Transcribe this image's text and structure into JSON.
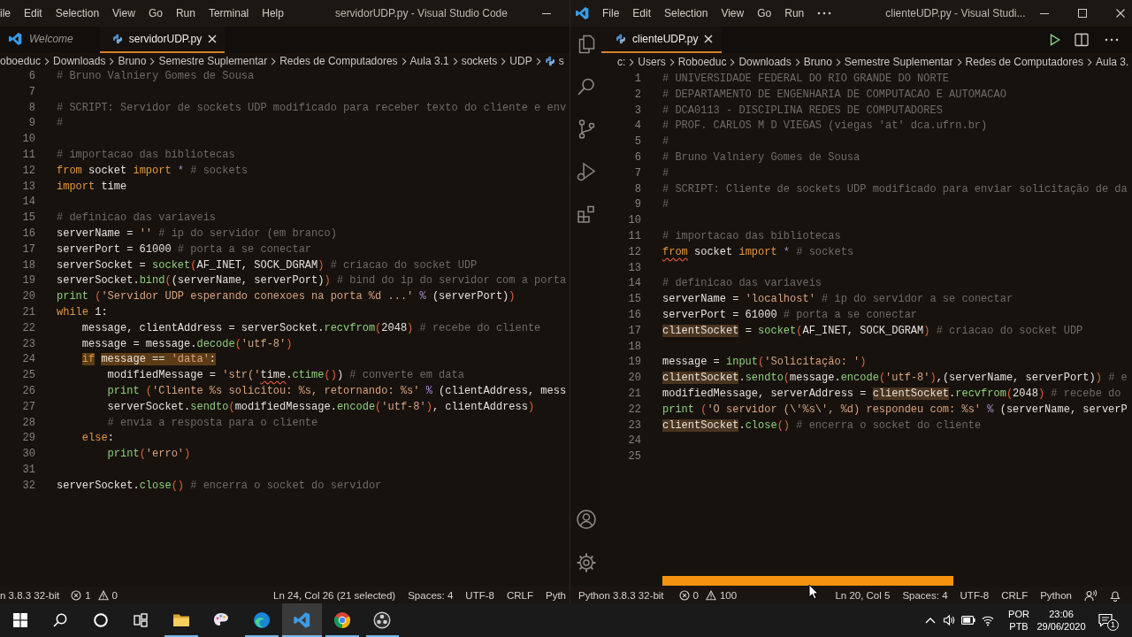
{
  "left_window": {
    "menu": [
      "ile",
      "Edit",
      "Selection",
      "View",
      "Go",
      "Run",
      "Terminal",
      "Help"
    ],
    "title": "servidorUDP.py - Visual Studio Code",
    "tabs": [
      {
        "label": "Welcome",
        "kind": "welcome",
        "selected": false
      },
      {
        "label": "servidorUDP.py",
        "kind": "file",
        "selected": true
      }
    ],
    "breadcrumb": [
      "oboeduc",
      "Downloads",
      "Bruno",
      "Semestre Suplementar",
      "Redes de Computadores",
      "Aula 3.1",
      "sockets",
      "UDP"
    ],
    "breadcrumb_file": "s",
    "code_lines": [
      {
        "number": "6",
        "tokens": [
          {
            "text": "# Bruno Valniery Gomes de Sousa",
            "kind": "comment",
            "highlighted": false,
            "squiggle": false
          }
        ]
      },
      {
        "number": "7"
      },
      {
        "number": "8",
        "tokens": [
          {
            "text": "# SCRIPT: Servidor de sockets UDP modificado para receber texto do cliente e env",
            "kind": "comment",
            "highlighted": false,
            "squiggle": false
          }
        ]
      },
      {
        "number": "9",
        "tokens": [
          {
            "text": "#",
            "kind": "comment",
            "highlighted": false,
            "squiggle": false
          }
        ]
      },
      {
        "number": "10"
      },
      {
        "number": "11",
        "tokens": [
          {
            "text": "# importacao das bibliotecas",
            "kind": "comment",
            "highlighted": false,
            "squiggle": false
          }
        ]
      },
      {
        "number": "12",
        "tokens": [
          {
            "text": "from",
            "kind": "keyword",
            "highlighted": false,
            "squiggle": false
          },
          {
            "text": " socket ",
            "kind": "plain",
            "highlighted": false,
            "squiggle": false
          },
          {
            "text": "import",
            "kind": "keyword",
            "highlighted": false,
            "squiggle": false
          },
          {
            "text": " *",
            "kind": "operator",
            "highlighted": false,
            "squiggle": false
          },
          {
            "text": " # sockets",
            "kind": "comment",
            "highlighted": false,
            "squiggle": false
          }
        ]
      },
      {
        "number": "13",
        "tokens": [
          {
            "text": "import",
            "kind": "keyword",
            "highlighted": false,
            "squiggle": false
          },
          {
            "text": " time",
            "kind": "plain",
            "highlighted": false,
            "squiggle": false
          }
        ]
      },
      {
        "number": "14"
      },
      {
        "number": "15",
        "tokens": [
          {
            "text": "# definicao das variaveis",
            "kind": "comment",
            "highlighted": false,
            "squiggle": false
          }
        ]
      },
      {
        "number": "16",
        "tokens": [
          {
            "text": "serverName = ",
            "kind": "plain",
            "highlighted": false,
            "squiggle": false
          },
          {
            "text": "''",
            "kind": "string",
            "highlighted": false,
            "squiggle": false
          },
          {
            "text": " # ip do servidor (em branco)",
            "kind": "comment",
            "highlighted": false,
            "squiggle": false
          }
        ]
      },
      {
        "number": "17",
        "tokens": [
          {
            "text": "serverPort = 61000",
            "kind": "plain",
            "highlighted": false,
            "squiggle": false
          },
          {
            "text": " # porta a se conectar",
            "kind": "comment",
            "highlighted": false,
            "squiggle": false
          }
        ]
      },
      {
        "number": "18",
        "tokens": [
          {
            "text": "serverSocket = ",
            "kind": "plain",
            "highlighted": false,
            "squiggle": false
          },
          {
            "text": "socket",
            "kind": "function",
            "highlighted": false,
            "squiggle": false
          },
          {
            "text": "(",
            "kind": "bracket",
            "highlighted": false,
            "squiggle": false
          },
          {
            "text": "AF_INET, SOCK_DGRAM",
            "kind": "plain",
            "highlighted": false,
            "squiggle": false
          },
          {
            "text": ")",
            "kind": "bracket",
            "highlighted": false,
            "squiggle": false
          },
          {
            "text": " # criacao do socket UDP",
            "kind": "comment",
            "highlighted": false,
            "squiggle": false
          }
        ]
      },
      {
        "number": "19",
        "tokens": [
          {
            "text": "serverSocket.",
            "kind": "plain",
            "highlighted": false,
            "squiggle": false
          },
          {
            "text": "bind",
            "kind": "function",
            "highlighted": false,
            "squiggle": false
          },
          {
            "text": "(",
            "kind": "bracket",
            "highlighted": false,
            "squiggle": false
          },
          {
            "text": "(serverName, serverPort)",
            "kind": "plain",
            "highlighted": false,
            "squiggle": false
          },
          {
            "text": ")",
            "kind": "bracket",
            "highlighted": false,
            "squiggle": false
          },
          {
            "text": " # bind do ip do servidor com a porta",
            "kind": "comment",
            "highlighted": false,
            "squiggle": false
          }
        ]
      },
      {
        "number": "20",
        "tokens": [
          {
            "text": "print",
            "kind": "function",
            "highlighted": false,
            "squiggle": false
          },
          {
            "text": " (",
            "kind": "bracket",
            "highlighted": false,
            "squiggle": false
          },
          {
            "text": "'Servidor UDP esperando conexoes na porta %d ...'",
            "kind": "string",
            "highlighted": false,
            "squiggle": false
          },
          {
            "text": " %",
            "kind": "operator",
            "highlighted": false,
            "squiggle": false
          },
          {
            "text": " (serverPort)",
            "kind": "plain",
            "highlighted": false,
            "squiggle": false
          },
          {
            "text": ")",
            "kind": "bracket",
            "highlighted": false,
            "squiggle": false
          }
        ]
      },
      {
        "number": "21",
        "tokens": [
          {
            "text": "while",
            "kind": "keyword",
            "highlighted": false,
            "squiggle": false
          },
          {
            "text": " 1:",
            "kind": "plain",
            "highlighted": false,
            "squiggle": false
          }
        ]
      },
      {
        "number": "22",
        "tokens": [
          {
            "text": "    message, clientAddress = serverSocket.",
            "kind": "plain",
            "highlighted": false,
            "squiggle": false
          },
          {
            "text": "recvfrom",
            "kind": "function",
            "highlighted": false,
            "squiggle": false
          },
          {
            "text": "(",
            "kind": "bracket",
            "highlighted": false,
            "squiggle": false
          },
          {
            "text": "2048",
            "kind": "plain",
            "highlighted": false,
            "squiggle": false
          },
          {
            "text": ")",
            "kind": "bracket",
            "highlighted": false,
            "squiggle": false
          },
          {
            "text": " # recebe do cliente",
            "kind": "comment",
            "highlighted": false,
            "squiggle": false
          }
        ]
      },
      {
        "number": "23",
        "tokens": [
          {
            "text": "    message = message.",
            "kind": "plain",
            "highlighted": false,
            "squiggle": false
          },
          {
            "text": "decode",
            "kind": "function",
            "highlighted": false,
            "squiggle": false
          },
          {
            "text": "(",
            "kind": "bracket",
            "highlighted": false,
            "squiggle": false
          },
          {
            "text": "'utf-8'",
            "kind": "string",
            "highlighted": false,
            "squiggle": false
          },
          {
            "text": ")",
            "kind": "bracket",
            "highlighted": false,
            "squiggle": false
          }
        ]
      },
      {
        "number": "24",
        "tokens": [
          {
            "text": "    if",
            "kind": "keyword",
            "highlighted": true,
            "squiggle": false
          },
          {
            "text": " message == ",
            "kind": "plain",
            "highlighted": true,
            "squiggle": false
          },
          {
            "text": "'data'",
            "kind": "string",
            "highlighted": true,
            "squiggle": false
          },
          {
            "text": ":",
            "kind": "plain",
            "highlighted": true,
            "squiggle": false
          }
        ]
      },
      {
        "number": "25",
        "tokens": [
          {
            "text": "        modifiedMessage = ",
            "kind": "plain",
            "highlighted": false,
            "squiggle": false
          },
          {
            "text": "'str('",
            "kind": "string",
            "highlighted": false,
            "squiggle": false
          },
          {
            "text": "time",
            "kind": "plain",
            "highlighted": false,
            "squiggle": true
          },
          {
            "text": ".",
            "kind": "plain",
            "highlighted": false,
            "squiggle": false
          },
          {
            "text": "ctime",
            "kind": "function",
            "highlighted": false,
            "squiggle": false
          },
          {
            "text": "()",
            "kind": "bracket",
            "highlighted": false,
            "squiggle": false
          },
          {
            "text": ")",
            "kind": "plain",
            "highlighted": false,
            "squiggle": false
          },
          {
            "text": " # converte em data",
            "kind": "comment",
            "highlighted": false,
            "squiggle": false
          }
        ]
      },
      {
        "number": "26",
        "tokens": [
          {
            "text": "        print",
            "kind": "function",
            "highlighted": false,
            "squiggle": false
          },
          {
            "text": " (",
            "kind": "bracket",
            "highlighted": false,
            "squiggle": false
          },
          {
            "text": "'Cliente %s solicitou: %s, retornando: %s'",
            "kind": "string",
            "highlighted": false,
            "squiggle": false
          },
          {
            "text": " %",
            "kind": "operator",
            "highlighted": false,
            "squiggle": false
          },
          {
            "text": " (clientAddress, mess",
            "kind": "plain",
            "highlighted": false,
            "squiggle": false
          }
        ]
      },
      {
        "number": "27",
        "tokens": [
          {
            "text": "        serverSocket.",
            "kind": "plain",
            "highlighted": false,
            "squiggle": false
          },
          {
            "text": "sendto",
            "kind": "function",
            "highlighted": false,
            "squiggle": false
          },
          {
            "text": "(",
            "kind": "bracket",
            "highlighted": false,
            "squiggle": false
          },
          {
            "text": "modifiedMessage.",
            "kind": "plain",
            "highlighted": false,
            "squiggle": false
          },
          {
            "text": "encode",
            "kind": "function",
            "highlighted": false,
            "squiggle": false
          },
          {
            "text": "(",
            "kind": "bracket",
            "highlighted": false,
            "squiggle": false
          },
          {
            "text": "'utf-8'",
            "kind": "string",
            "highlighted": false,
            "squiggle": false
          },
          {
            "text": ")",
            "kind": "bracket",
            "highlighted": false,
            "squiggle": false
          },
          {
            "text": ", clientAddress",
            "kind": "plain",
            "highlighted": false,
            "squiggle": false
          },
          {
            "text": ")",
            "kind": "bracket",
            "highlighted": false,
            "squiggle": false
          }
        ]
      },
      {
        "number": "28",
        "tokens": [
          {
            "text": "        # envia a resposta para o cliente",
            "kind": "comment",
            "highlighted": false,
            "squiggle": false
          }
        ]
      },
      {
        "number": "29",
        "tokens": [
          {
            "text": "    else",
            "kind": "keyword",
            "highlighted": false,
            "squiggle": false
          },
          {
            "text": ":",
            "kind": "plain",
            "highlighted": false,
            "squiggle": false
          }
        ]
      },
      {
        "number": "30",
        "tokens": [
          {
            "text": "        print",
            "kind": "function",
            "highlighted": false,
            "squiggle": false
          },
          {
            "text": "(",
            "kind": "bracket",
            "highlighted": false,
            "squiggle": false
          },
          {
            "text": "'erro'",
            "kind": "string",
            "highlighted": false,
            "squiggle": false
          },
          {
            "text": ")",
            "kind": "bracket",
            "highlighted": false,
            "squiggle": false
          }
        ]
      },
      {
        "number": "31"
      },
      {
        "number": "32",
        "tokens": [
          {
            "text": "serverSocket.",
            "kind": "plain",
            "highlighted": false,
            "squiggle": false
          },
          {
            "text": "close",
            "kind": "function",
            "highlighted": false,
            "squiggle": false
          },
          {
            "text": "()",
            "kind": "bracket",
            "highlighted": false,
            "squiggle": false
          },
          {
            "text": " # encerra o socket do servidor",
            "kind": "comment",
            "highlighted": false,
            "squiggle": false
          }
        ]
      }
    ],
    "status": {
      "interpreter": "n 3.8.3 32-bit",
      "errors": "1",
      "warnings": "0",
      "position": "Ln 24, Col 26 (21 selected)",
      "indentation": "Spaces: 4",
      "encoding": "UTF-8",
      "line_ending": "CRLF",
      "language": "Pyth"
    }
  },
  "right_window": {
    "menu": [
      "File",
      "Edit",
      "Selection",
      "View",
      "Go",
      "Run"
    ],
    "title": "clienteUDP.py - Visual Studi...",
    "tabs": [
      {
        "label": "clienteUDP.py",
        "kind": "file",
        "selected": true
      }
    ],
    "breadcrumb": [
      "c:",
      "Users",
      "Roboeduc",
      "Downloads",
      "Bruno",
      "Semestre Suplementar",
      "Redes de Computadores",
      "Aula 3."
    ],
    "code_lines": [
      {
        "number": "1",
        "tokens": [
          {
            "text": "# UNIVERSIDADE FEDERAL DO RIO GRANDE DO NORTE",
            "kind": "comment",
            "highlighted": false,
            "squiggle": false
          }
        ]
      },
      {
        "number": "2",
        "tokens": [
          {
            "text": "# DEPARTAMENTO DE ENGENHARIA DE COMPUTACAO E AUTOMACAO",
            "kind": "comment",
            "highlighted": false,
            "squiggle": false
          }
        ]
      },
      {
        "number": "3",
        "tokens": [
          {
            "text": "# DCA0113 - DISCIPLINA REDES DE COMPUTADORES",
            "kind": "comment",
            "highlighted": false,
            "squiggle": false
          }
        ]
      },
      {
        "number": "4",
        "tokens": [
          {
            "text": "# PROF. CARLOS M D VIEGAS (viegas 'at' dca.ufrn.br)",
            "kind": "comment",
            "highlighted": false,
            "squiggle": false
          }
        ]
      },
      {
        "number": "5",
        "tokens": [
          {
            "text": "#",
            "kind": "comment",
            "highlighted": false,
            "squiggle": false
          }
        ]
      },
      {
        "number": "6",
        "tokens": [
          {
            "text": "# Bruno Valniery Gomes de Sousa",
            "kind": "comment",
            "highlighted": false,
            "squiggle": false
          }
        ]
      },
      {
        "number": "7",
        "tokens": [
          {
            "text": "#",
            "kind": "comment",
            "highlighted": false,
            "squiggle": false
          }
        ]
      },
      {
        "number": "8",
        "tokens": [
          {
            "text": "# SCRIPT: Cliente de sockets UDP modificado para enviar solicitação de da",
            "kind": "comment",
            "highlighted": false,
            "squiggle": false
          }
        ]
      },
      {
        "number": "9",
        "tokens": [
          {
            "text": "#",
            "kind": "comment",
            "highlighted": false,
            "squiggle": false
          }
        ]
      },
      {
        "number": "10"
      },
      {
        "number": "11",
        "tokens": [
          {
            "text": "# importacao das bibliotecas",
            "kind": "comment",
            "highlighted": false,
            "squiggle": false
          }
        ]
      },
      {
        "number": "12",
        "tokens": [
          {
            "text": "from",
            "kind": "keyword",
            "highlighted": false,
            "squiggle": true
          },
          {
            "text": " socket ",
            "kind": "plain",
            "highlighted": false,
            "squiggle": false
          },
          {
            "text": "import",
            "kind": "keyword",
            "highlighted": false,
            "squiggle": false
          },
          {
            "text": " *",
            "kind": "operator",
            "highlighted": false,
            "squiggle": false
          },
          {
            "text": " # sockets",
            "kind": "comment",
            "highlighted": false,
            "squiggle": false
          }
        ]
      },
      {
        "number": "13"
      },
      {
        "number": "14",
        "tokens": [
          {
            "text": "# definicao das variaveis",
            "kind": "comment",
            "highlighted": false,
            "squiggle": false
          }
        ]
      },
      {
        "number": "15",
        "tokens": [
          {
            "text": "serverName = ",
            "kind": "plain",
            "highlighted": false,
            "squiggle": false
          },
          {
            "text": "'localhost'",
            "kind": "string",
            "highlighted": false,
            "squiggle": false
          },
          {
            "text": " # ip do servidor a se conectar",
            "kind": "comment",
            "highlighted": false,
            "squiggle": false
          }
        ]
      },
      {
        "number": "16",
        "tokens": [
          {
            "text": "serverPort = 61000",
            "kind": "plain",
            "highlighted": false,
            "squiggle": false
          },
          {
            "text": " # porta a se conectar",
            "kind": "comment",
            "highlighted": false,
            "squiggle": false
          }
        ]
      },
      {
        "number": "17",
        "tokens": [
          {
            "text": "clientSocket",
            "kind": "plain",
            "highlighted": true,
            "squiggle": false
          },
          {
            "text": " = ",
            "kind": "plain",
            "highlighted": false,
            "squiggle": false
          },
          {
            "text": "socket",
            "kind": "function",
            "highlighted": false,
            "squiggle": false
          },
          {
            "text": "(",
            "kind": "bracket",
            "highlighted": false,
            "squiggle": false
          },
          {
            "text": "AF_INET, SOCK_DGRAM",
            "kind": "plain",
            "highlighted": false,
            "squiggle": false
          },
          {
            "text": ")",
            "kind": "bracket",
            "highlighted": false,
            "squiggle": false
          },
          {
            "text": " # criacao do socket UDP",
            "kind": "comment",
            "highlighted": false,
            "squiggle": false
          }
        ]
      },
      {
        "number": "18"
      },
      {
        "number": "19",
        "tokens": [
          {
            "text": "message = ",
            "kind": "plain",
            "highlighted": false,
            "squiggle": false
          },
          {
            "text": "input",
            "kind": "function",
            "highlighted": false,
            "squiggle": false
          },
          {
            "text": "(",
            "kind": "bracket",
            "highlighted": false,
            "squiggle": false
          },
          {
            "text": "'Solicitação: '",
            "kind": "string",
            "highlighted": false,
            "squiggle": false
          },
          {
            "text": ")",
            "kind": "bracket",
            "highlighted": false,
            "squiggle": false
          }
        ]
      },
      {
        "number": "20",
        "tokens": [
          {
            "text": "clientSocket",
            "kind": "plain",
            "highlighted": true,
            "squiggle": false
          },
          {
            "text": ".",
            "kind": "plain",
            "highlighted": false,
            "squiggle": false
          },
          {
            "text": "sendto",
            "kind": "function",
            "highlighted": false,
            "squiggle": false
          },
          {
            "text": "(",
            "kind": "bracket",
            "highlighted": false,
            "squiggle": false
          },
          {
            "text": "message.",
            "kind": "plain",
            "highlighted": false,
            "squiggle": false
          },
          {
            "text": "encode",
            "kind": "function",
            "highlighted": false,
            "squiggle": false
          },
          {
            "text": "(",
            "kind": "bracket",
            "highlighted": false,
            "squiggle": false
          },
          {
            "text": "'utf-8'",
            "kind": "string",
            "highlighted": false,
            "squiggle": false
          },
          {
            "text": ")",
            "kind": "bracket",
            "highlighted": false,
            "squiggle": false
          },
          {
            "text": ",(serverName, serverPort)",
            "kind": "plain",
            "highlighted": false,
            "squiggle": false
          },
          {
            "text": ")",
            "kind": "bracket",
            "highlighted": false,
            "squiggle": false
          },
          {
            "text": " # e",
            "kind": "comment",
            "highlighted": false,
            "squiggle": false
          }
        ]
      },
      {
        "number": "21",
        "tokens": [
          {
            "text": "modifiedMessage, serverAddress = ",
            "kind": "plain",
            "highlighted": false,
            "squiggle": false
          },
          {
            "text": "clientSocket",
            "kind": "plain",
            "highlighted": true,
            "squiggle": false
          },
          {
            "text": ".",
            "kind": "plain",
            "highlighted": false,
            "squiggle": false
          },
          {
            "text": "recvfrom",
            "kind": "function",
            "highlighted": false,
            "squiggle": false
          },
          {
            "text": "(",
            "kind": "bracket",
            "highlighted": false,
            "squiggle": false
          },
          {
            "text": "2048",
            "kind": "plain",
            "highlighted": false,
            "squiggle": false
          },
          {
            "text": ")",
            "kind": "bracket",
            "highlighted": false,
            "squiggle": false
          },
          {
            "text": " # recebe do",
            "kind": "comment",
            "highlighted": false,
            "squiggle": false
          }
        ]
      },
      {
        "number": "22",
        "tokens": [
          {
            "text": "print",
            "kind": "function",
            "highlighted": false,
            "squiggle": false
          },
          {
            "text": " (",
            "kind": "bracket",
            "highlighted": false,
            "squiggle": false
          },
          {
            "text": "'O servidor (\\'%s\\', %d) respondeu com: %s'",
            "kind": "string",
            "highlighted": false,
            "squiggle": false
          },
          {
            "text": " %",
            "kind": "operator",
            "highlighted": false,
            "squiggle": false
          },
          {
            "text": " (serverName, serverP",
            "kind": "plain",
            "highlighted": false,
            "squiggle": false
          }
        ]
      },
      {
        "number": "23",
        "tokens": [
          {
            "text": "clientSocket",
            "kind": "plain",
            "highlighted": true,
            "squiggle": false
          },
          {
            "text": ".",
            "kind": "plain",
            "highlighted": false,
            "squiggle": false
          },
          {
            "text": "close",
            "kind": "function",
            "highlighted": false,
            "squiggle": false
          },
          {
            "text": "()",
            "kind": "bracket",
            "highlighted": false,
            "squiggle": false
          },
          {
            "text": " # encerra o socket do cliente",
            "kind": "comment",
            "highlighted": false,
            "squiggle": false
          }
        ]
      },
      {
        "number": "24"
      },
      {
        "number": "25"
      }
    ],
    "status": {
      "interpreter": "Python 3.8.3 32-bit",
      "errors": "0",
      "warnings": "100",
      "position": "Ln 20, Col 5",
      "indentation": "Spaces: 4",
      "encoding": "UTF-8",
      "line_ending": "CRLF",
      "language": "Python"
    }
  },
  "taskbar": {
    "buttons": [
      {
        "kind": "start",
        "selected": false,
        "running": false
      },
      {
        "kind": "search",
        "selected": false,
        "running": false
      },
      {
        "kind": "assistant",
        "selected": false,
        "running": false
      },
      {
        "kind": "task-view",
        "selected": false,
        "running": false
      },
      {
        "kind": "folder",
        "selected": false,
        "running": true
      },
      {
        "kind": "paint",
        "selected": false,
        "running": false
      },
      {
        "kind": "browser",
        "selected": false,
        "running": true
      },
      {
        "kind": "editor",
        "selected": true,
        "running": true
      },
      {
        "kind": "browser-alt",
        "selected": false,
        "running": true
      },
      {
        "kind": "recorder",
        "selected": false,
        "running": true
      }
    ],
    "tray": {
      "language": "POR",
      "layout": "PTB",
      "time": "23:06",
      "date": "29/06/2020",
      "notifications": "1"
    }
  }
}
